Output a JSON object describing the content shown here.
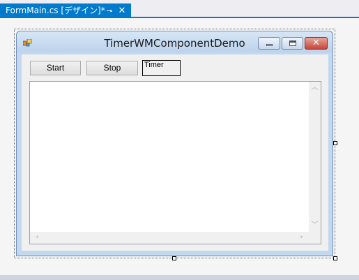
{
  "tab": {
    "title": "FormMain.cs [デザイン]*",
    "pin_glyph": "⊸",
    "close_glyph": "✕"
  },
  "form": {
    "title": "TimerWMComponentDemo"
  },
  "caption_buttons": {
    "close_glyph": "✕"
  },
  "buttons": {
    "start_label": "Start",
    "stop_label": "Stop"
  },
  "timer": {
    "label": "Timer"
  },
  "scrollbars": {
    "up": "︿",
    "down": "﹀",
    "left": "‹",
    "right": "›"
  },
  "colors": {
    "accent": "#007acc",
    "form_frame": "#c3d7ee",
    "close_button": "#c6453a"
  }
}
